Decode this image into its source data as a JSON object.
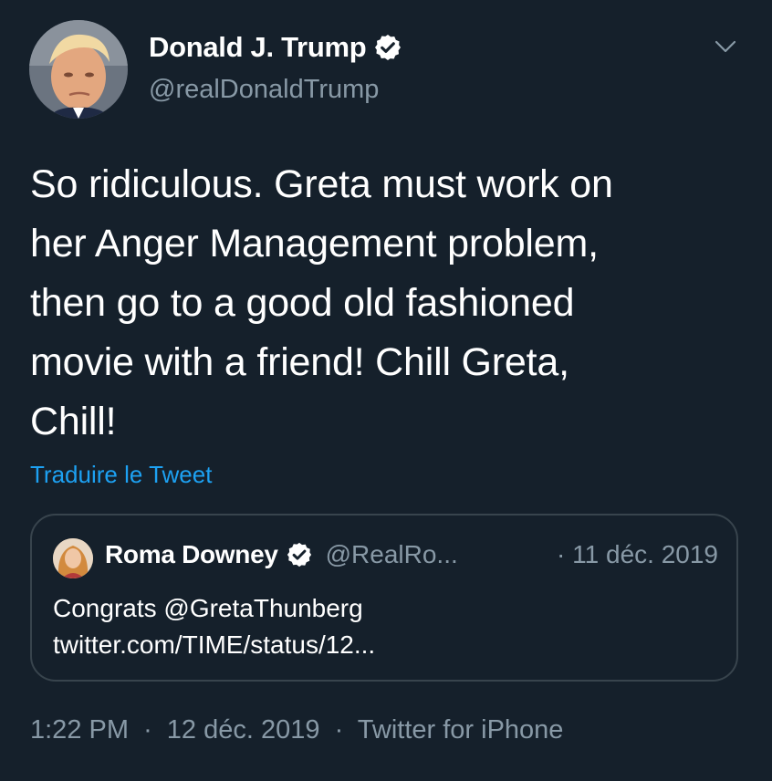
{
  "author": {
    "name": "Donald J. Trump",
    "handle": "@realDonaldTrump",
    "verified_icon": "verified-badge-icon",
    "avatar_icon": "user-avatar"
  },
  "menu": {
    "icon": "chevron-down-icon"
  },
  "tweet": {
    "text": "So ridiculous. Greta must work on\nher Anger Management problem,\nthen go to a good old fashioned\nmovie with a friend! Chill Greta,\nChill!",
    "translate_label": "Traduire le Tweet"
  },
  "quoted": {
    "name": "Roma Downey",
    "handle": "@RealRo...",
    "date": "· 11 déc. 2019",
    "text": "Congrats @GretaThunberg\ntwitter.com/TIME/status/12..."
  },
  "meta": {
    "time": "1:22 PM",
    "separator": "·",
    "date": "12 déc. 2019",
    "source": "Twitter for iPhone"
  },
  "colors": {
    "background": "#15202b",
    "text": "#ffffff",
    "secondary": "#8899a6",
    "link": "#1da1f2",
    "border": "#38444d"
  }
}
